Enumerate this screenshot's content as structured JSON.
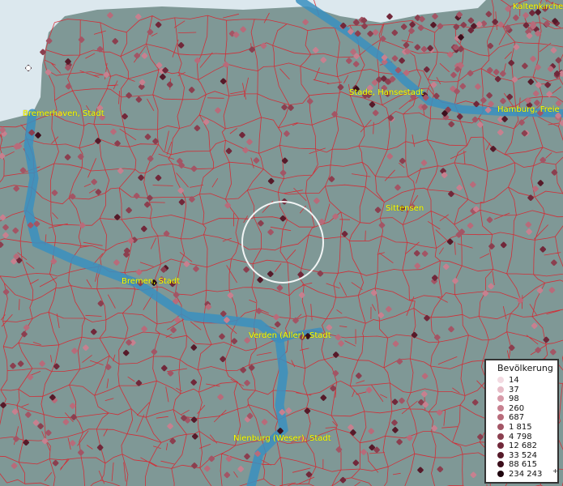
{
  "map": {
    "places": [
      {
        "id": "kaltenkirchen",
        "label": "Kaltenkirche"
      },
      {
        "id": "bremerhaven",
        "label": "Bremerhaven, Stadt"
      },
      {
        "id": "stade",
        "label": "Stade, Hansestadt"
      },
      {
        "id": "hamburg",
        "label": "Hamburg, Freie"
      },
      {
        "id": "sittensen",
        "label": "Sittensen"
      },
      {
        "id": "bremen",
        "label": "Bremen, Stadt"
      },
      {
        "id": "verden",
        "label": "Verden (Aller), Stadt"
      },
      {
        "id": "nienburg",
        "label": "Nienburg (Weser), Stadt"
      }
    ],
    "colors": {
      "land": "#7f9896",
      "sea": "#dce8ee",
      "river": "#3a8fbf",
      "boundaries": "#d9242d",
      "label": "#ffff00",
      "selection_circle": "#ffffff"
    },
    "legend": {
      "title": "Bevölkerung",
      "items": [
        {
          "label": "14",
          "color": "#f3dbe2"
        },
        {
          "label": "37",
          "color": "#e7bcc7"
        },
        {
          "label": "98",
          "color": "#d79aa8"
        },
        {
          "label": "260",
          "color": "#c7808f"
        },
        {
          "label": "687",
          "color": "#b86b7a"
        },
        {
          "label": "1 815",
          "color": "#a35565"
        },
        {
          "label": "4 798",
          "color": "#8b3f4f"
        },
        {
          "label": "12 682",
          "color": "#71283a"
        },
        {
          "label": "33 524",
          "color": "#561a29"
        },
        {
          "label": "88 615",
          "color": "#3c0e1b"
        },
        {
          "label": "234 243",
          "color": "#1f050e"
        }
      ],
      "overflow_mark": "+"
    }
  }
}
